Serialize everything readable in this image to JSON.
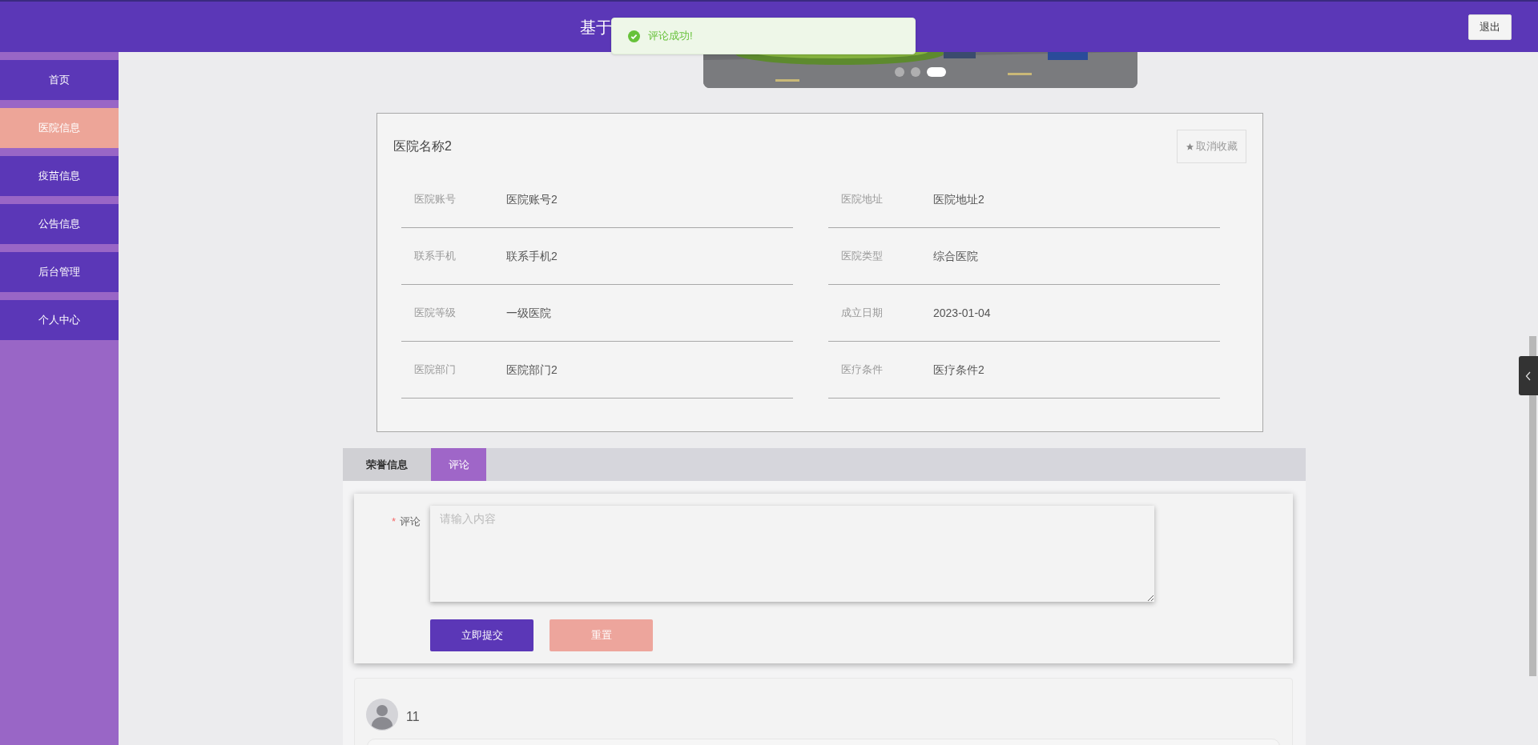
{
  "header": {
    "title": "基于",
    "logout": "退出"
  },
  "toast": {
    "message": "评论成功!"
  },
  "carousel": {
    "dots": [
      {
        "selected": false
      },
      {
        "selected": false
      },
      {
        "selected": true
      }
    ]
  },
  "sidebar": {
    "items": [
      {
        "label": "首页",
        "selected": false
      },
      {
        "label": "医院信息",
        "selected": true
      },
      {
        "label": "疫苗信息",
        "selected": false
      },
      {
        "label": "公告信息",
        "selected": false
      },
      {
        "label": "后台管理",
        "selected": false
      },
      {
        "label": "个人中心",
        "selected": false
      }
    ]
  },
  "detail": {
    "title": "医院名称2",
    "favorite_button": "取消收藏",
    "fields": [
      {
        "label": "医院账号",
        "value": "医院账号2"
      },
      {
        "label": "医院地址",
        "value": "医院地址2"
      },
      {
        "label": "联系手机",
        "value": "联系手机2"
      },
      {
        "label": "医院类型",
        "value": "综合医院"
      },
      {
        "label": "医院等级",
        "value": "一级医院"
      },
      {
        "label": "成立日期",
        "value": "2023-01-04"
      },
      {
        "label": "医院部门",
        "value": "医院部门2"
      },
      {
        "label": "医疗条件",
        "value": "医疗条件2"
      }
    ]
  },
  "tabs": [
    {
      "label": "荣誉信息",
      "selected": false
    },
    {
      "label": "评论",
      "selected": true
    }
  ],
  "comment_form": {
    "required_mark": "*",
    "label": "评论",
    "placeholder": "请输入内容",
    "submit": "立即提交",
    "reset": "重置"
  },
  "comments": [
    {
      "user": "11"
    }
  ]
}
